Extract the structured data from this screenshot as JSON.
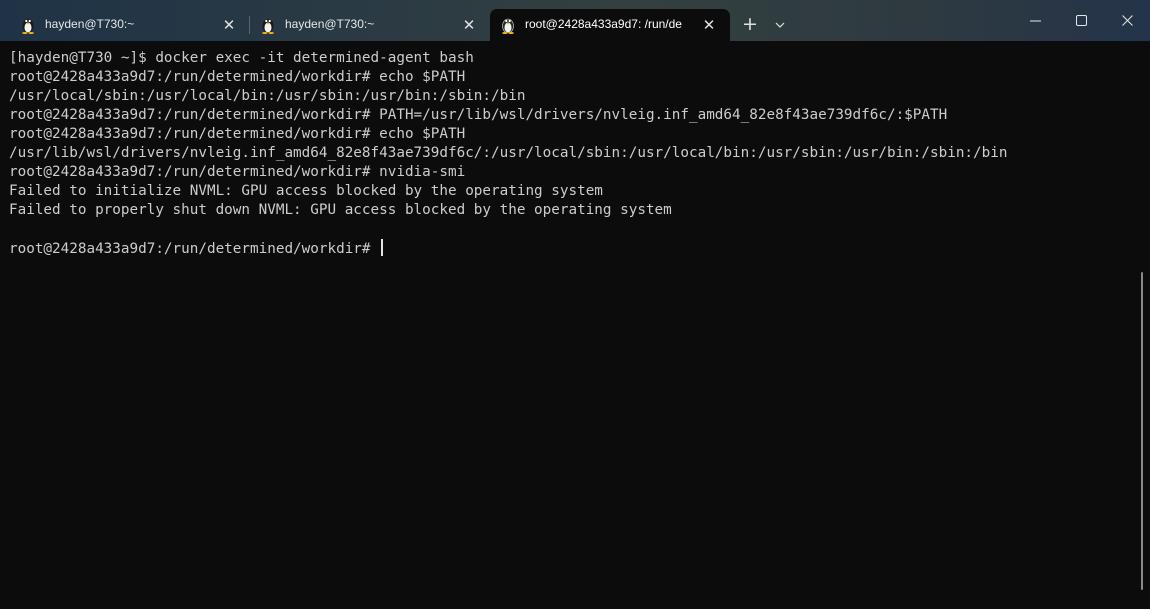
{
  "tabs": [
    {
      "title": "hayden@T730:~",
      "icon": "linux-penguin-icon",
      "active": false
    },
    {
      "title": "hayden@T730:~",
      "icon": "linux-penguin-icon",
      "active": false
    },
    {
      "title": "root@2428a433a9d7: /run/de",
      "icon": "linux-penguin-icon",
      "active": true
    }
  ],
  "titlebar": {
    "new_tab": "+",
    "dropdown": "⌵"
  },
  "window_controls": [
    "minimize",
    "maximize",
    "close"
  ],
  "terminal": {
    "lines": [
      "[hayden@T730 ~]$ docker exec -it determined-agent bash",
      "root@2428a433a9d7:/run/determined/workdir# echo $PATH",
      "/usr/local/sbin:/usr/local/bin:/usr/sbin:/usr/bin:/sbin:/bin",
      "root@2428a433a9d7:/run/determined/workdir# PATH=/usr/lib/wsl/drivers/nvleig.inf_amd64_82e8f43ae739df6c/:$PATH",
      "root@2428a433a9d7:/run/determined/workdir# echo $PATH",
      "/usr/lib/wsl/drivers/nvleig.inf_amd64_82e8f43ae739df6c/:/usr/local/sbin:/usr/local/bin:/usr/sbin:/usr/bin:/sbin:/bin",
      "root@2428a433a9d7:/run/determined/workdir# nvidia-smi",
      "Failed to initialize NVML: GPU access blocked by the operating system",
      "Failed to properly shut down NVML: GPU access blocked by the operating system",
      "",
      "root@2428a433a9d7:/run/determined/workdir# "
    ]
  },
  "colors": {
    "terminal_bg": "#0c0c0c",
    "terminal_fg": "#cccccc"
  }
}
